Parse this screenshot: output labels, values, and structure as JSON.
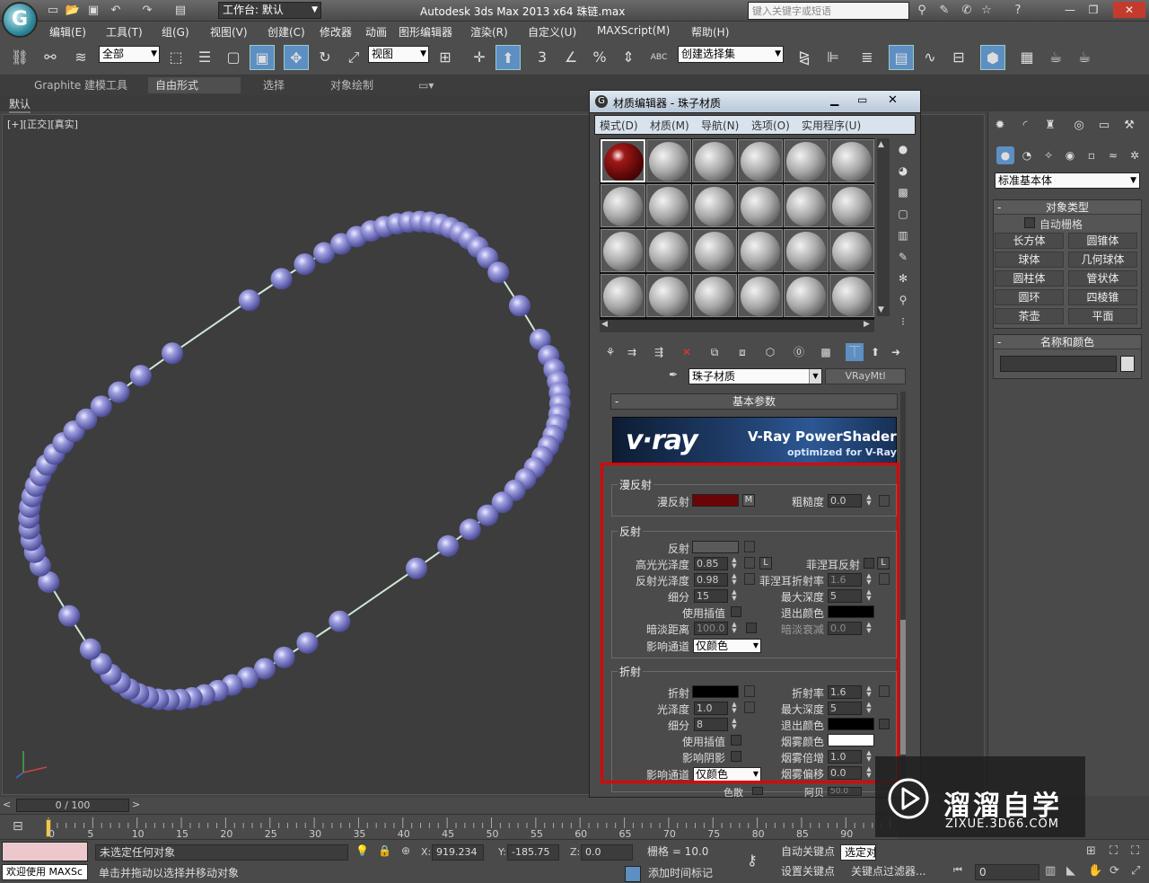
{
  "app": {
    "title": "Autodesk 3ds Max  2013 x64      珠链.max",
    "logo_letter": "G",
    "workspace": "工作台: 默认",
    "search_placeholder": "键入关键字或短语"
  },
  "menus": [
    "编辑(E)",
    "工具(T)",
    "组(G)",
    "视图(V)",
    "创建(C)",
    "修改器",
    "动画",
    "图形编辑器",
    "渲染(R)",
    "自定义(U)",
    "MAXScript(M)",
    "帮助(H)"
  ],
  "toolbar": {
    "selection_filter": "全部",
    "ref_coord": "视图",
    "named_selection": "创建选择集",
    "snap_labels": [
      "3",
      "%",
      "ABC"
    ]
  },
  "ribbon": {
    "tabs": [
      "Graphite 建模工具",
      "自由形式",
      "选择",
      "对象绘制"
    ],
    "sub_label": "默认"
  },
  "viewport": {
    "label": "[+][正交][真实]",
    "bead_color": "#9d9ddf",
    "string_color": "#cfe7d6"
  },
  "command_panel": {
    "category": "标准基本体",
    "object_type_header": "对象类型",
    "auto_grid": "自动栅格",
    "buttons": [
      "长方体",
      "圆锥体",
      "球体",
      "几何球体",
      "圆柱体",
      "管状体",
      "圆环",
      "四棱锥",
      "茶壶",
      "平面"
    ],
    "name_color_header": "名称和颜色"
  },
  "material_editor": {
    "title": "材质编辑器 - 珠子材质",
    "menus": [
      "模式(D)",
      "材质(M)",
      "导航(N)",
      "选项(O)",
      "实用程序(U)"
    ],
    "material_name": "珠子材质",
    "material_type": "VRayMtl",
    "basic_params": "基本参数",
    "banner": {
      "brand": "v·ray",
      "title": "V-Ray PowerShader",
      "subtitle": "optimized for V-Ray"
    },
    "diffuse": {
      "group": "漫反射",
      "label": "漫反射",
      "color": "#6b0505",
      "map_btn": "M",
      "roughness_label": "粗糙度",
      "roughness": "0.0"
    },
    "reflection": {
      "group": "反射",
      "reflect_label": "反射",
      "hilight_gloss_label": "高光光泽度",
      "hilight_gloss": "0.85",
      "lock": "L",
      "fresnel_label": "菲涅耳反射",
      "fresnel_lock": "L",
      "refl_gloss_label": "反射光泽度",
      "refl_gloss": "0.98",
      "fresnel_ior_label": "菲涅耳折射率",
      "fresnel_ior": "1.6",
      "subdivs_label": "细分",
      "subdivs": "15",
      "max_depth_label": "最大深度",
      "max_depth": "5",
      "use_interp_label": "使用插值",
      "exit_color_label": "退出颜色",
      "dim_dist_label": "暗淡距离",
      "dim_dist": "100.0",
      "dim_falloff_label": "暗淡衰减",
      "dim_falloff": "0.0",
      "affect_label": "影响通道",
      "affect": "仅颜色"
    },
    "refraction": {
      "group": "折射",
      "refract_label": "折射",
      "ior_label": "折射率",
      "ior": "1.6",
      "gloss_label": "光泽度",
      "gloss": "1.0",
      "max_depth_label": "最大深度",
      "max_depth": "5",
      "subdivs_label": "细分",
      "subdivs": "8",
      "exit_color_label": "退出颜色",
      "use_interp_label": "使用插值",
      "fog_color_label": "烟雾颜色",
      "affect_shadows_label": "影响阴影",
      "fog_mult_label": "烟雾倍增",
      "fog_mult": "1.0",
      "affect_label": "影响通道",
      "affect": "仅颜色",
      "fog_bias_label": "烟雾偏移",
      "fog_bias": "0.0",
      "dispersion_label": "色散",
      "abbe_label": "阿贝",
      "abbe": "50.0"
    }
  },
  "timeline": {
    "frame": "0 / 100",
    "ticks": [
      "0",
      "5",
      "10",
      "15",
      "20",
      "25",
      "30",
      "35",
      "40",
      "45",
      "50",
      "55",
      "60",
      "65",
      "70",
      "75",
      "80",
      "85",
      "90"
    ]
  },
  "status": {
    "welcome": "欢迎使用 MAXSc",
    "selection": "未选定任何对象",
    "prompt": "单击并拖动以选择并移动对象",
    "x_label": "X:",
    "x": "919.234",
    "y_label": "Y:",
    "y": "-185.75",
    "z_label": "Z:",
    "z": "0.0",
    "grid": "栅格 = 10.0",
    "auto_key": "自动关键点",
    "selected": "选定对",
    "set_key": "设置关键点",
    "key_filters": "关键点过滤器...",
    "add_time_tag": "添加时间标记",
    "frame_field": "0"
  },
  "watermark": {
    "brand": "溜溜自学",
    "url": "ZIXUE.3D66.COM"
  }
}
